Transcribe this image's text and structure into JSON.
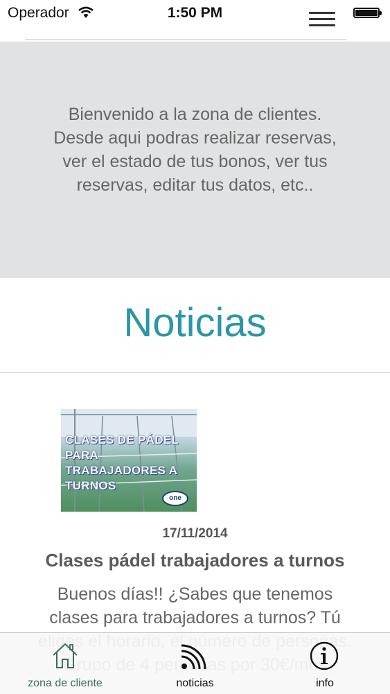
{
  "status_bar": {
    "carrier": "Operador",
    "time": "1:50 PM"
  },
  "header": {
    "menu_icon": "hamburger-menu-icon"
  },
  "welcome": {
    "text": "Bienvenido a la zona de clientes. Desde aqui podras realizar reservas, ver el estado de tus bonos, ver tus reservas, editar tus datos, etc.."
  },
  "news": {
    "title": "Noticias",
    "items": [
      {
        "image_caption": "CLASES DE PÁDEL PARA TRABAJADORES A TURNOS",
        "image_logo": "one",
        "date": "17/11/2014",
        "headline": "Clases pádel trabajadores a turnos",
        "body": "Buenos días!! ¿Sabes que tenemos clases para trabajadores a turnos? Tú eliges el horario, el número de personas. Grupo de 4 personas por 30€/mes"
      }
    ]
  },
  "tab_bar": {
    "active_color": "#3d6b5e",
    "tabs": [
      {
        "label": "zona de cliente",
        "icon": "home-icon"
      },
      {
        "label": "noticias",
        "icon": "rss-feed-icon"
      },
      {
        "label": "info",
        "icon": "info-icon"
      }
    ]
  },
  "colors": {
    "accent": "#2a96a8",
    "welcome_bg": "#e1e2e3"
  }
}
